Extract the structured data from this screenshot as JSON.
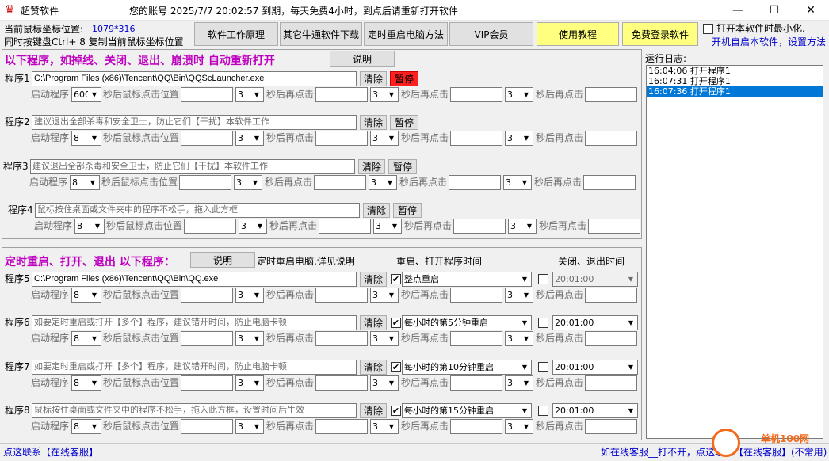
{
  "window": {
    "title": "超赞软件",
    "minimize": "—",
    "maximize": "☐",
    "close": "✕"
  },
  "account_notice": "您的账号 2025/7/7 20:02:57 到期，每天免费4小时，到点后请重新打开软件",
  "coords": {
    "label": "当前鼠标坐标位置:",
    "value": "1079*316",
    "hint": "同时按键盘Ctrl+ 8 复制当前鼠标坐标位置"
  },
  "toolbar": {
    "principle": "软件工作原理",
    "other_download": "其它牛通软件下载",
    "timed_restart": "定时重启电脑方法",
    "vip": "VIP会员",
    "tutorial": "使用教程",
    "free_login": "免费登录软件"
  },
  "minimize_option": {
    "label": "打开本软件时最小化.",
    "startup_link": "开机自启本软件，设置方法"
  },
  "section1": {
    "heading": "以下程序，如掉线、关闭、退出、崩溃时 自动重新打开",
    "explain": "说明"
  },
  "section2": {
    "heading": "定时重启、打开、退出 以下程序：",
    "explain": "说明",
    "restart_pc_note": "定时重启电脑.详见说明",
    "col_open_time": "重启、打开程序时间",
    "col_close_time": "关闭、退出时间"
  },
  "labels": {
    "start_prog": "启动程序",
    "click_after": "秒后鼠标点击位置",
    "click_again": "秒后再点击",
    "clear": "清除",
    "pause": "暂停"
  },
  "programs": [
    {
      "label": "程序1",
      "path": "C:\\Program Files (x86)\\Tencent\\QQ\\Bin\\QQScLauncher.exe",
      "delay": "600",
      "d2": "3",
      "d3": "3",
      "d4": "3"
    },
    {
      "label": "程序2",
      "path": "建议退出全部杀毒和安全卫士，防止它们【干扰】本软件工作",
      "delay": "8",
      "d2": "3",
      "d3": "3",
      "d4": "3"
    },
    {
      "label": "程序3",
      "path": "建议退出全部杀毒和安全卫士，防止它们【干扰】本软件工作",
      "delay": "8",
      "d2": "3",
      "d3": "3",
      "d4": "3"
    },
    {
      "label": "程序4",
      "path": "鼠标按住桌面或文件夹中的程序不松手，拖入此方框",
      "delay": "8",
      "d2": "3",
      "d3": "3",
      "d4": "3"
    },
    {
      "label": "程序5",
      "path": "C:\\Program Files (x86)\\Tencent\\QQ\\Bin\\QQ.exe",
      "delay": "8",
      "d2": "3",
      "d3": "3",
      "d4": "3",
      "open_time": "整点重启",
      "close_time": "20:01:00"
    },
    {
      "label": "程序6",
      "path": "如要定时重启或打开【多个】程序，建议错开时间，防止电脑卡顿",
      "delay": "8",
      "d2": "3",
      "d3": "3",
      "d4": "3",
      "open_time": "每小时的第5分钟重启",
      "close_time": "20:01:00"
    },
    {
      "label": "程序7",
      "path": "如要定时重启或打开【多个】程序，建议错开时间，防止电脑卡顿",
      "delay": "8",
      "d2": "3",
      "d3": "3",
      "d4": "3",
      "open_time": "每小时的第10分钟重启",
      "close_time": "20:01:00"
    },
    {
      "label": "程序8",
      "path": "鼠标按住桌面或文件夹中的程序不松手，拖入此方框，设置时间后生效",
      "delay": "8",
      "d2": "3",
      "d3": "3",
      "d4": "3",
      "open_time": "每小时的第15分钟重启",
      "close_time": "20:01:00"
    }
  ],
  "log": {
    "title": "运行日志:",
    "lines": [
      "16:04:06 打开程序1",
      "16:07:31 打开程序1",
      "16:07:36 打开程序1"
    ]
  },
  "footer": {
    "left": "点这联系【在线客服】",
    "right": "如在线客服__打不开，点这联系【在线客服】(不常用)",
    "watermark": "单机100网"
  },
  "colors": {
    "heading": "#c000c0",
    "link": "#0000cc",
    "highlight_button": "#ffff80",
    "pause_red": "#ff2020",
    "log_selected": "#0078d7"
  }
}
